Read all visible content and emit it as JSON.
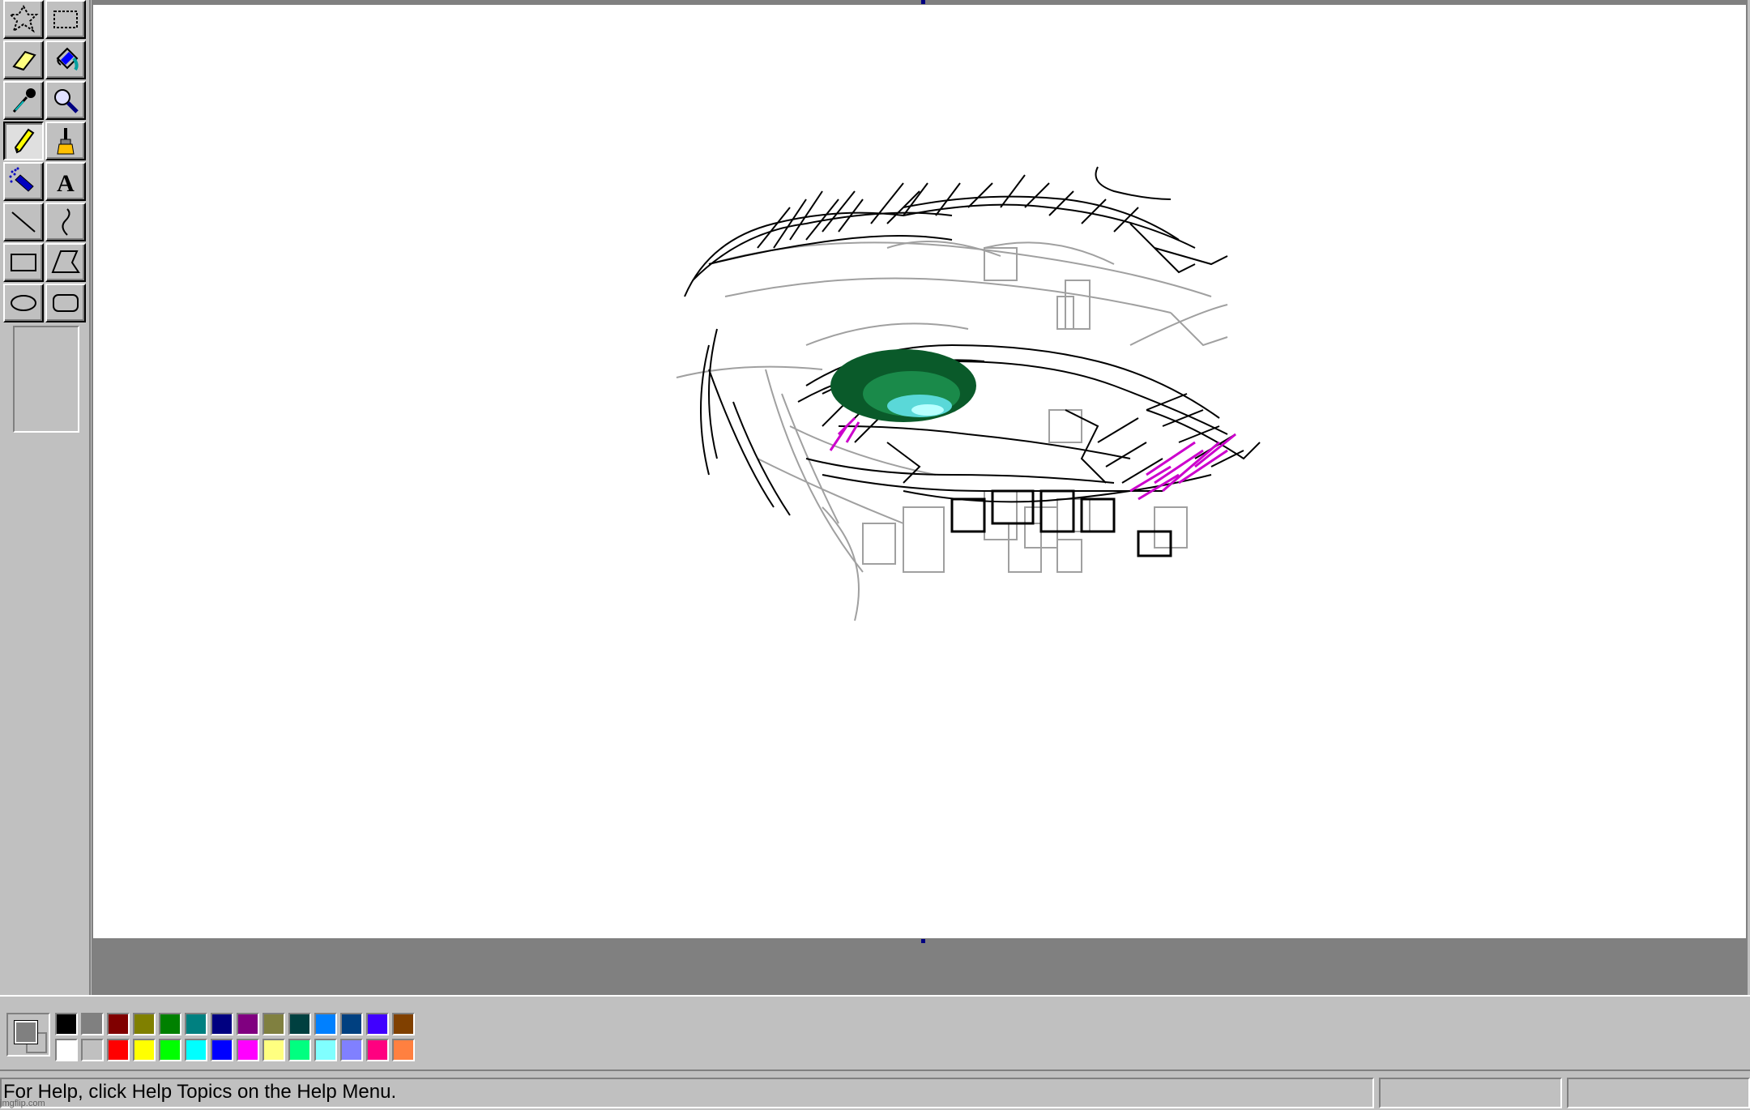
{
  "toolbox": {
    "tools": [
      {
        "id": "free-form-select",
        "icon": "free-form-select-icon"
      },
      {
        "id": "select",
        "icon": "rect-select-icon"
      },
      {
        "id": "eraser",
        "icon": "eraser-icon"
      },
      {
        "id": "fill",
        "icon": "fill-bucket-icon"
      },
      {
        "id": "pick-color",
        "icon": "eyedropper-icon"
      },
      {
        "id": "magnifier",
        "icon": "magnifier-icon"
      },
      {
        "id": "pencil",
        "icon": "pencil-icon",
        "selected": true
      },
      {
        "id": "brush",
        "icon": "brush-icon"
      },
      {
        "id": "airbrush",
        "icon": "airbrush-icon"
      },
      {
        "id": "text",
        "icon": "text-icon",
        "glyph": "A"
      },
      {
        "id": "line",
        "icon": "line-icon"
      },
      {
        "id": "curve",
        "icon": "curve-icon"
      },
      {
        "id": "rectangle",
        "icon": "rectangle-icon"
      },
      {
        "id": "polygon",
        "icon": "polygon-icon"
      },
      {
        "id": "ellipse",
        "icon": "ellipse-icon"
      },
      {
        "id": "rounded-rectangle",
        "icon": "rounded-rectangle-icon"
      }
    ]
  },
  "colors": {
    "foreground": "#808080",
    "background": "#c0c0c0",
    "palette_top": [
      "#000000",
      "#808080",
      "#800000",
      "#808000",
      "#008000",
      "#008080",
      "#000080",
      "#800080",
      "#808040",
      "#004040",
      "#0080ff",
      "#004080",
      "#4000ff",
      "#804000"
    ],
    "palette_bottom": [
      "#ffffff",
      "#c0c0c0",
      "#ff0000",
      "#ffff00",
      "#00ff00",
      "#00ffff",
      "#0000ff",
      "#ff00ff",
      "#ffff80",
      "#00ff80",
      "#80ffff",
      "#8080ff",
      "#ff0080",
      "#ff8040"
    ]
  },
  "canvas": {
    "drawing": "eye-sketch"
  },
  "status": {
    "help_text": "For Help, click Help Topics on the Help Menu.",
    "pane2": "",
    "pane3": ""
  },
  "watermark": "imgflip.com"
}
